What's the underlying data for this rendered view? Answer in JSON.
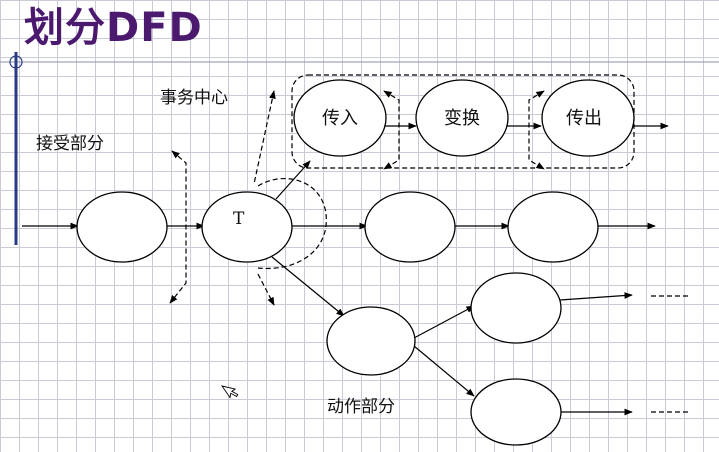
{
  "title": "划分DFD",
  "labels": {
    "transaction_center": "事务中心",
    "receive_part": "接受部分",
    "action_part": "动作部分"
  },
  "nodes": {
    "incoming": "传入",
    "transform": "变换",
    "outgoing": "传出",
    "transaction": "T"
  }
}
